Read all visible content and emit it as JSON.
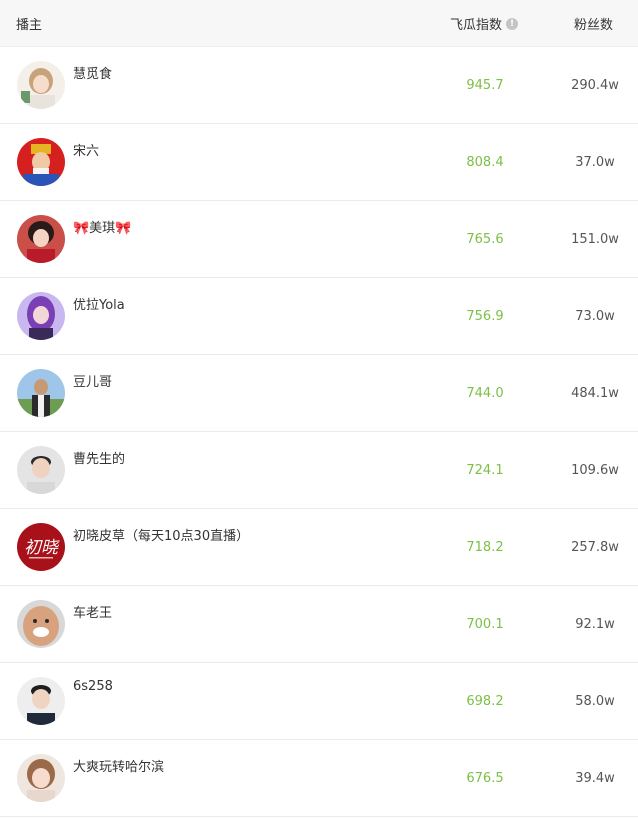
{
  "header": {
    "anchor": "播主",
    "index": "飞瓜指数",
    "fans": "粉丝数"
  },
  "rows": [
    {
      "name": "慧觅食",
      "index": "945.7",
      "fans": "290.4w"
    },
    {
      "name": "宋六",
      "index": "808.4",
      "fans": "37.0w"
    },
    {
      "name": "🎀美琪🎀",
      "index": "765.6",
      "fans": "151.0w"
    },
    {
      "name": "优拉Yola",
      "index": "756.9",
      "fans": "73.0w"
    },
    {
      "name": "豆儿哥",
      "index": "744.0",
      "fans": "484.1w"
    },
    {
      "name": "曹先生的",
      "index": "724.1",
      "fans": "109.6w"
    },
    {
      "name": "初晓皮草（每天10点30直播）",
      "index": "718.2",
      "fans": "257.8w"
    },
    {
      "name": "车老王",
      "index": "700.1",
      "fans": "92.1w"
    },
    {
      "name": "6s258",
      "index": "698.2",
      "fans": "58.0w"
    },
    {
      "name": "大爽玩转哈尔滨",
      "index": "676.5",
      "fans": "39.4w"
    }
  ]
}
